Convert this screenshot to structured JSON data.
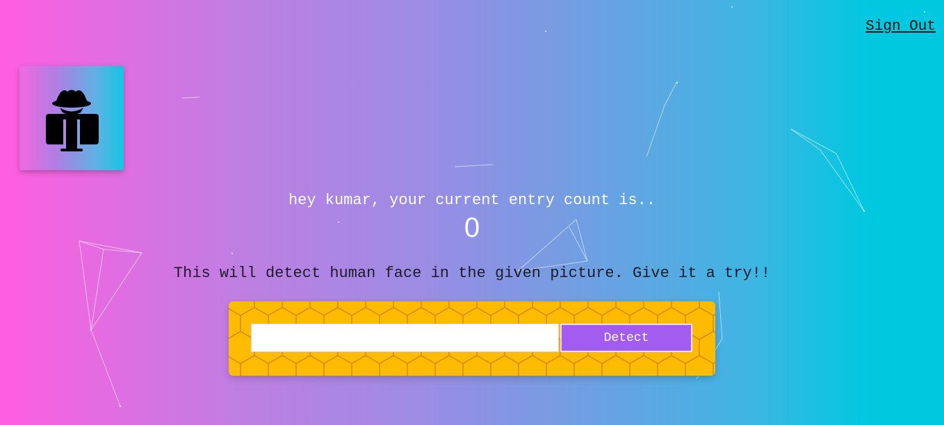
{
  "nav": {
    "sign_out_label": "Sign Out"
  },
  "logo": {
    "icon": "incognito-user-icon"
  },
  "greeting": {
    "text": "hey kumar, your current entry count is..",
    "count": "0"
  },
  "detector": {
    "description": "This will detect human face in the given picture. Give it a try!!",
    "input_value": "",
    "input_placeholder": "",
    "button_label": "Detect"
  },
  "colors": {
    "gradient_left": "#ff5ee0",
    "gradient_right": "#00c8e0",
    "panel": "#ffbb00",
    "button": "#a35cf0"
  }
}
